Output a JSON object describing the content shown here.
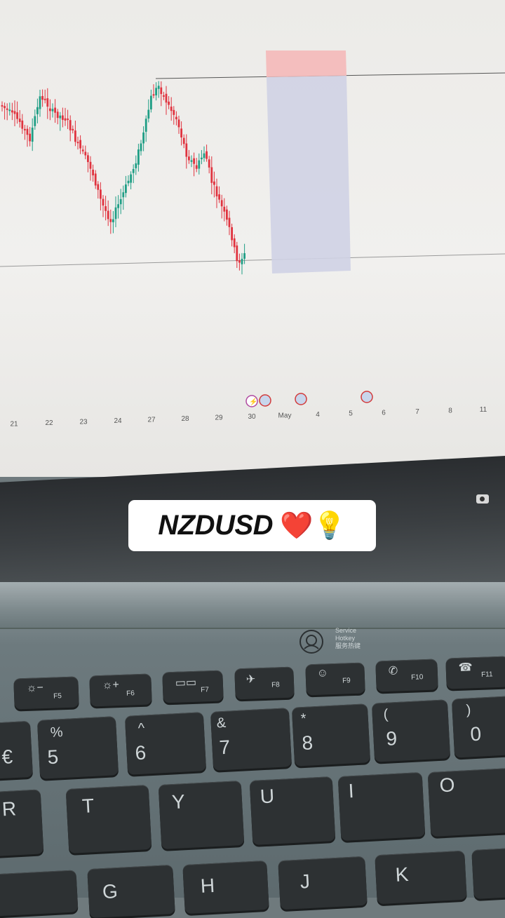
{
  "caption": {
    "text": "NZDUSD",
    "emoji": "❤️💡"
  },
  "chart": {
    "date_ticks": [
      "21",
      "22",
      "23",
      "24",
      "27",
      "28",
      "29",
      "30",
      "May",
      "4",
      "5",
      "6",
      "7",
      "8",
      "11"
    ],
    "colors": {
      "up": "#1f9e85",
      "down": "#e0333f",
      "risk_zone": "#f2b8b8",
      "reward_zone": "#cdd1e3"
    }
  },
  "laptop": {
    "service_label": [
      "Service",
      "Hotkey",
      "服务热键"
    ],
    "function_keys": [
      "F5",
      "F6",
      "F7",
      "F8",
      "F9",
      "F10",
      "F11"
    ],
    "number_keys": [
      {
        "top": "€",
        "bottom": ""
      },
      {
        "top": "%",
        "bottom": "5"
      },
      {
        "top": "^",
        "bottom": "6"
      },
      {
        "top": "&",
        "bottom": "7"
      },
      {
        "top": "*",
        "bottom": "8"
      },
      {
        "top": "(",
        "bottom": "9"
      },
      {
        "top": ")",
        "bottom": "0"
      }
    ],
    "letter_row": [
      "R",
      "T",
      "Y",
      "U",
      "I",
      "O"
    ],
    "bottom_row": [
      "G",
      "H",
      "J",
      "K"
    ]
  }
}
